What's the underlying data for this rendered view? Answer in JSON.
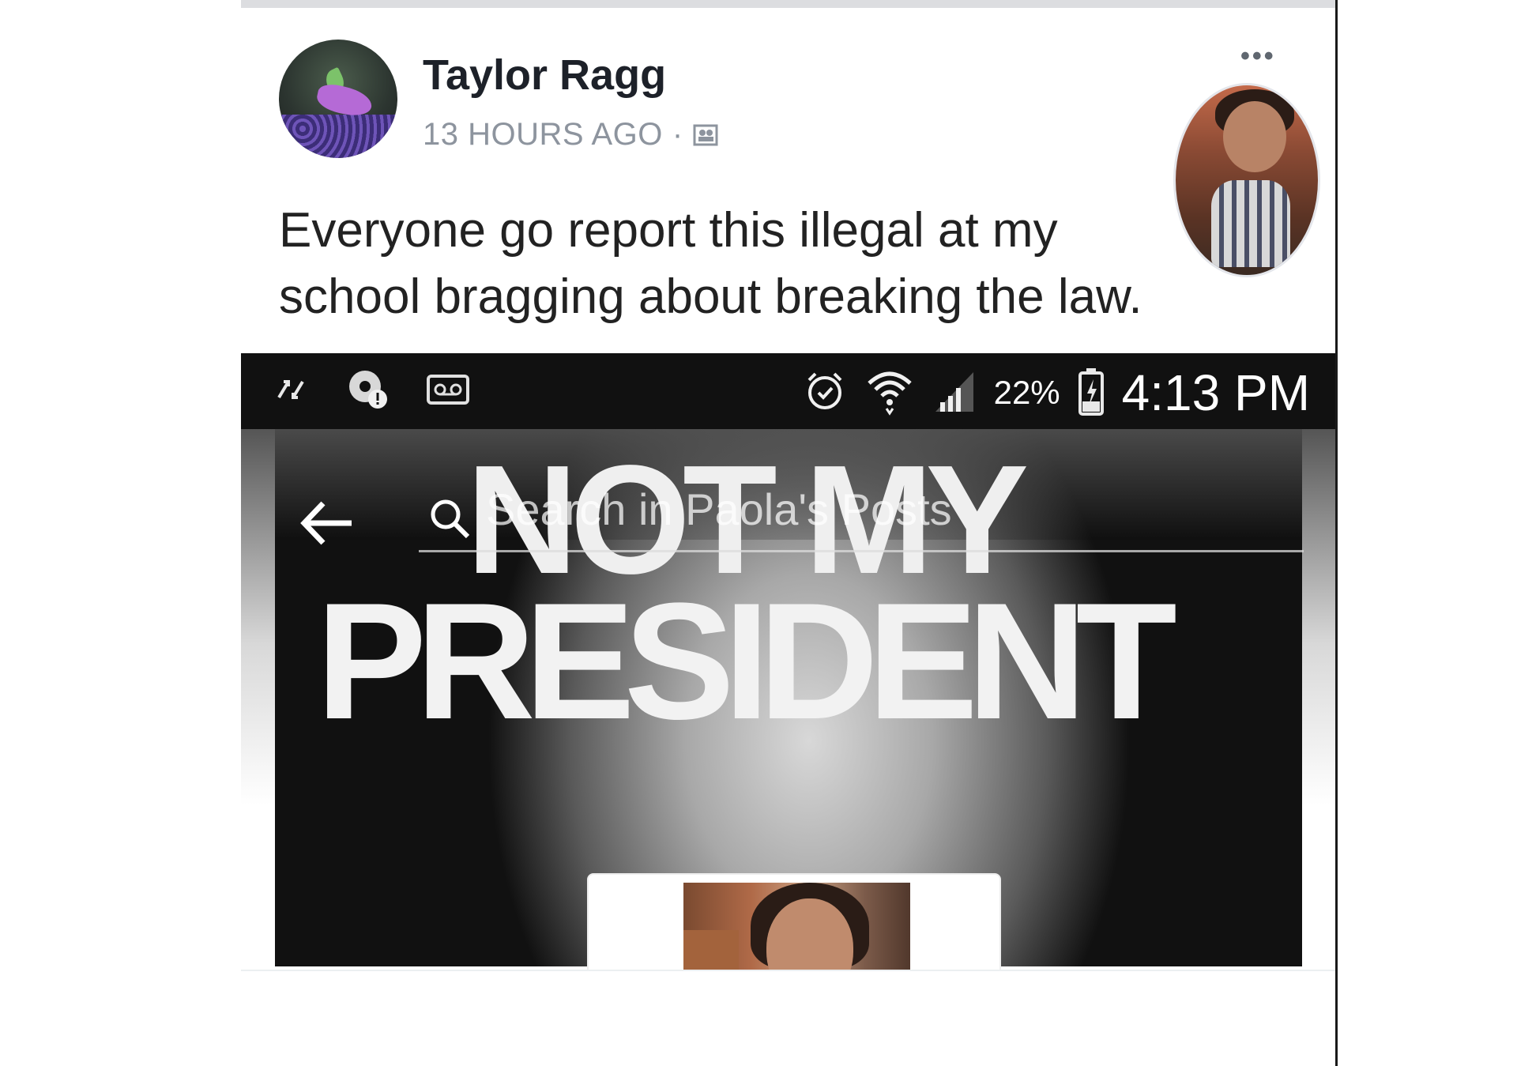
{
  "post": {
    "author": "Taylor Ragg",
    "timestamp": "13 HOURS AGO",
    "separator": "·",
    "audience_icon": "friends-icon",
    "more_label": "•••",
    "text": "Everyone go report this illegal at my school bragging about breaking the law."
  },
  "screenshot": {
    "status_bar": {
      "left_icons": [
        "data-transfer-icon",
        "location-alert-icon",
        "voicemail-icon"
      ],
      "right_icons": [
        "alarm-icon",
        "wifi-icon",
        "signal-icon",
        "battery-charging-icon"
      ],
      "battery": "22%",
      "time": "4:13 PM"
    },
    "search": {
      "back_icon": "back-arrow-icon",
      "search_icon": "search-icon",
      "placeholder": "Search in Paola's Posts"
    },
    "cover": {
      "line1": "NOT MY",
      "line2": "PRESIDENT"
    }
  }
}
